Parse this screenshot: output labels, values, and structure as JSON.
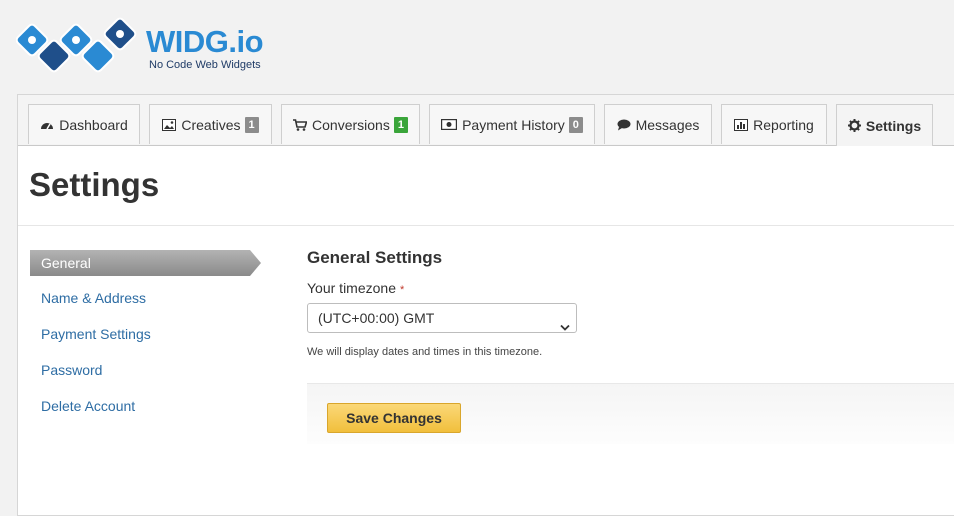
{
  "brand": {
    "name": "WIDG.io",
    "tagline": "No Code Web Widgets",
    "color": "#2a8ad3"
  },
  "tabs": [
    {
      "label": "Dashboard",
      "icon": "dashboard-icon"
    },
    {
      "label": "Creatives",
      "icon": "image-icon",
      "badge": "1"
    },
    {
      "label": "Conversions",
      "icon": "cart-icon",
      "badge": "1"
    },
    {
      "label": "Payment History",
      "icon": "money-icon",
      "badge": "0"
    },
    {
      "label": "Messages",
      "icon": "comment-icon"
    },
    {
      "label": "Reporting",
      "icon": "bar-chart-icon"
    },
    {
      "label": "Settings",
      "icon": "gear-icon",
      "active": true
    }
  ],
  "page": {
    "title": "Settings"
  },
  "sidenav": {
    "items": [
      {
        "label": "General",
        "active": true
      },
      {
        "label": "Name & Address"
      },
      {
        "label": "Payment Settings"
      },
      {
        "label": "Password"
      },
      {
        "label": "Delete Account"
      }
    ]
  },
  "general": {
    "title": "General Settings",
    "timezone_label": "Your timezone",
    "required_mark": "*",
    "timezone_value": "(UTC+00:00) GMT",
    "help": "We will display dates and times in this timezone.",
    "save_label": "Save Changes"
  },
  "colors": {
    "link": "#2e6da4",
    "badge_green": "#3aa53a",
    "badge_gray": "#8c8c8c",
    "save_button": "#f1bf3c"
  }
}
